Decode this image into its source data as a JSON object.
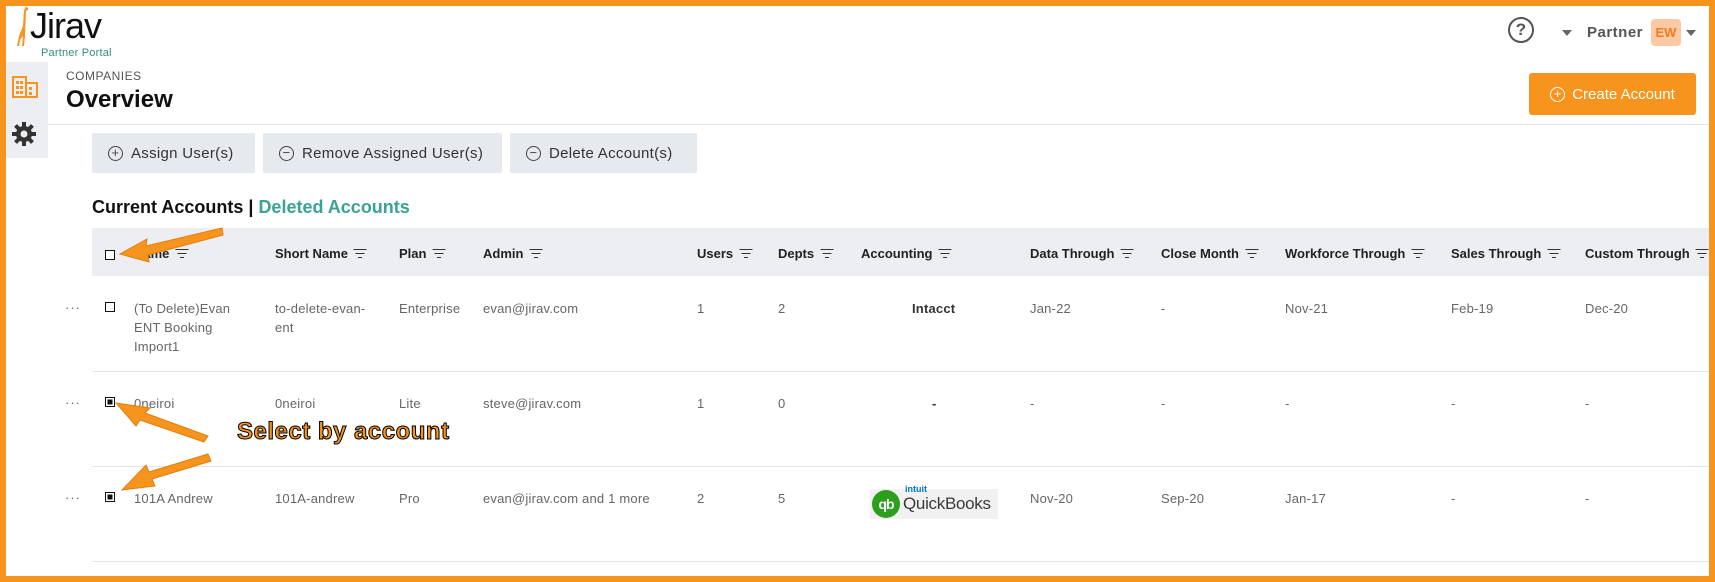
{
  "header": {
    "logo_text": "Jirav",
    "logo_subtitle": "Partner Portal",
    "help_icon": "question-circle-icon",
    "user_label": "Partner",
    "user_initials": "EW"
  },
  "sidebar": {
    "items": [
      {
        "icon": "building-icon",
        "accent": "#f7941d"
      },
      {
        "icon": "gear-icon",
        "accent": "#333333"
      }
    ]
  },
  "page": {
    "breadcrumb": "COMPANIES",
    "title": "Overview",
    "create_button": "Create Account"
  },
  "toolbar": {
    "assign": "Assign User(s)",
    "remove": "Remove Assigned User(s)",
    "delete": "Delete Account(s)"
  },
  "tabs": {
    "current": "Current Accounts",
    "separator": "|",
    "deleted": "Deleted Accounts"
  },
  "table": {
    "columns": [
      "Name",
      "Short Name",
      "Plan",
      "Admin",
      "Users",
      "Depts",
      "Accounting",
      "Data Through",
      "Close Month",
      "Workforce Through",
      "Sales Through",
      "Custom Through"
    ],
    "rows": [
      {
        "checked": false,
        "name": [
          "(To Delete)Evan",
          "ENT Booking",
          "Import1"
        ],
        "short_name": [
          "to-delete-evan-",
          "ent"
        ],
        "plan": "Enterprise",
        "admin": "evan@jirav.com",
        "users": "1",
        "depts": "2",
        "accounting": "Intacct",
        "data_through": "Jan-22",
        "close_month": "-",
        "workforce_through": "Nov-21",
        "sales_through": "Feb-19",
        "custom_through": "Dec-20"
      },
      {
        "checked": true,
        "name": [
          "0neiroi"
        ],
        "short_name": [
          "0neiroi"
        ],
        "plan": "Lite",
        "admin": "steve@jirav.com",
        "users": "1",
        "depts": "0",
        "accounting": "-",
        "data_through": "-",
        "close_month": "-",
        "workforce_through": "-",
        "sales_through": "-",
        "custom_through": "-"
      },
      {
        "checked": true,
        "name": [
          "101A Andrew"
        ],
        "short_name": [
          "101A-andrew"
        ],
        "plan": "Pro",
        "admin": "evan@jirav.com and 1 more",
        "users": "2",
        "depts": "5",
        "accounting": {
          "logo_prefix": "intuit",
          "logo_text": "QuickBooks",
          "logo_mark": "qb"
        },
        "data_through": "Nov-20",
        "close_month": "Sep-20",
        "workforce_through": "Jan-17",
        "sales_through": "-",
        "custom_through": "-"
      }
    ],
    "row_menu": "···"
  },
  "annotation": {
    "text": "Select by account",
    "color": "#f7941d"
  },
  "colors": {
    "frame": "#f7941d",
    "accent": "#f7941d",
    "link": "#3aa394",
    "toolbar_bg": "#e6e9ed"
  }
}
